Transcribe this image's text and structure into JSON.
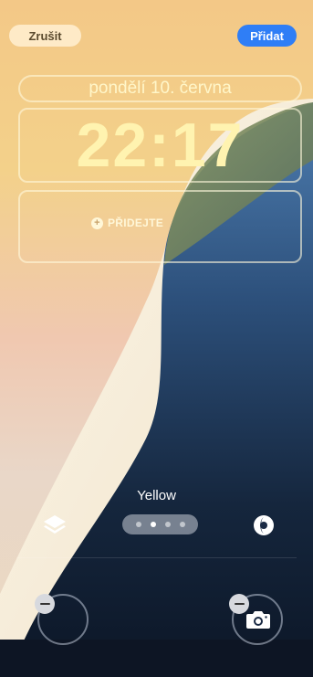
{
  "header": {
    "cancel_label": "Zrušit",
    "add_label": "Přidat"
  },
  "lock_screen": {
    "date": "pondělí 10. června",
    "time": "22:17",
    "widget_hint": "PŘIDEJTE"
  },
  "style_picker": {
    "current_style": "Yellow",
    "page_count": 4,
    "active_page": 2
  },
  "icons": {
    "layers": "layers-icon",
    "filter": "color-filter-icon",
    "camera": "camera-icon",
    "remove": "minus-icon"
  },
  "colors": {
    "accent": "#2f7ef6",
    "time_text": "#fff3b0"
  }
}
